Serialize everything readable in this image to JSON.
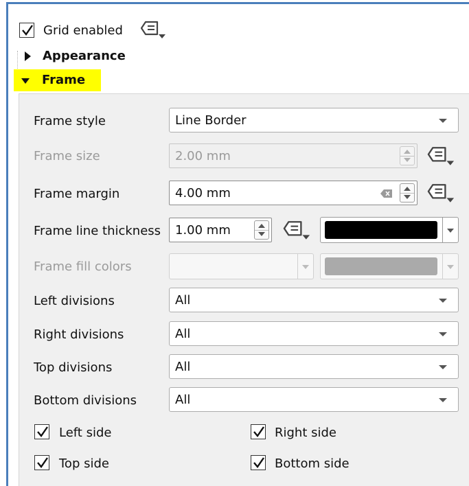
{
  "grid": {
    "enabled_label": "Grid enabled",
    "enabled": true
  },
  "sections": {
    "appearance": "Appearance",
    "frame": "Frame"
  },
  "colors": {
    "highlight": "#ffff00",
    "accent_border": "#4a7ebb",
    "line_color": "#000000",
    "fill_color": "#aaaaaa"
  },
  "frame": {
    "style": {
      "label": "Frame style",
      "value": "Line Border"
    },
    "size": {
      "label": "Frame size",
      "value": "2.00 mm",
      "enabled": false
    },
    "margin": {
      "label": "Frame margin",
      "value": "4.00 mm"
    },
    "line_thickness": {
      "label": "Frame line thickness",
      "value": "1.00 mm"
    },
    "fill_colors": {
      "label": "Frame fill colors",
      "enabled": false
    },
    "left_divisions": {
      "label": "Left divisions",
      "value": "All"
    },
    "right_divisions": {
      "label": "Right divisions",
      "value": "All"
    },
    "top_divisions": {
      "label": "Top divisions",
      "value": "All"
    },
    "bottom_divisions": {
      "label": "Bottom divisions",
      "value": "All"
    },
    "sides": {
      "left": {
        "label": "Left side",
        "checked": true
      },
      "right": {
        "label": "Right side",
        "checked": true
      },
      "top": {
        "label": "Top side",
        "checked": true
      },
      "bottom": {
        "label": "Bottom side",
        "checked": true
      }
    }
  },
  "icons": {
    "data_defined": "data-defined-override-icon",
    "check": "checkmark-icon",
    "expand": "triangle-right-icon",
    "collapse": "triangle-down-icon",
    "clear": "clear-field-icon"
  }
}
